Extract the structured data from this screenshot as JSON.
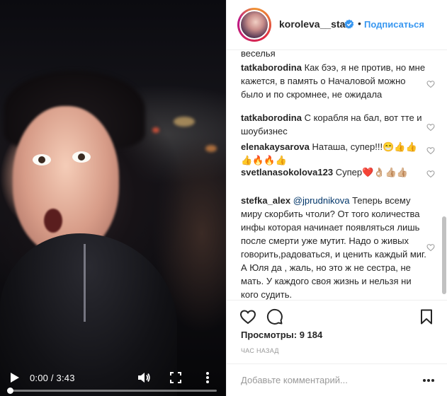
{
  "video": {
    "current_time": "0:00",
    "separator": " / ",
    "duration": "3:43",
    "progress": 0.0
  },
  "post": {
    "username": "koroleva__star",
    "verified": true,
    "dot": "•",
    "follow_label": "Подписаться"
  },
  "comments": [
    {
      "user": "",
      "mention": "",
      "text": "веселья"
    },
    {
      "user": "tatkaborodina",
      "mention": "",
      "text": "Как бээ, я не против, но мне кажется, в память о Началовой можно было и по скромнее, не ожидала"
    },
    {
      "user": "tatkaborodina",
      "mention": "",
      "text": "С корабля на бал, вот тте и шоубизнес"
    },
    {
      "user": "elenakaysarova",
      "mention": "",
      "text": "Наташа, супер!!!😁👍👍👍🔥🔥👍"
    },
    {
      "user": "svetlanasokolova123",
      "mention": "",
      "text": "Супер❤️👌🏼👍🏼👍🏼"
    },
    {
      "user": "stefka_alex",
      "mention": "@jprudnikova",
      "text": "Теперь всему миру скорбить чтоли? От того количества инфы которая начинает появляться лишь после смерти уже мутит. Надо о живых говорить,радоваться, и ценить каждый миг. А Юля да , жаль, но это ж не сестра, не мать. У каждого своя жизнь и нельзя ни кого судить."
    }
  ],
  "stats": {
    "views_label": "Просмотры:",
    "views_count": "9 184",
    "time_ago": "ЧАС НАЗАД"
  },
  "add_comment": {
    "placeholder": "Добавьте комментарий..."
  },
  "icons": {
    "play": "play-icon",
    "volume": "volume-icon",
    "fullscreen": "fullscreen-icon",
    "settings": "settings-icon",
    "like": "heart-icon",
    "comment": "comment-icon",
    "bookmark": "bookmark-icon",
    "verified": "verified-badge-icon",
    "more": "more-dots-icon"
  },
  "colors": {
    "accent": "#3897f0",
    "verified": "#3897f0",
    "text": "#262626",
    "muted": "#999999"
  }
}
